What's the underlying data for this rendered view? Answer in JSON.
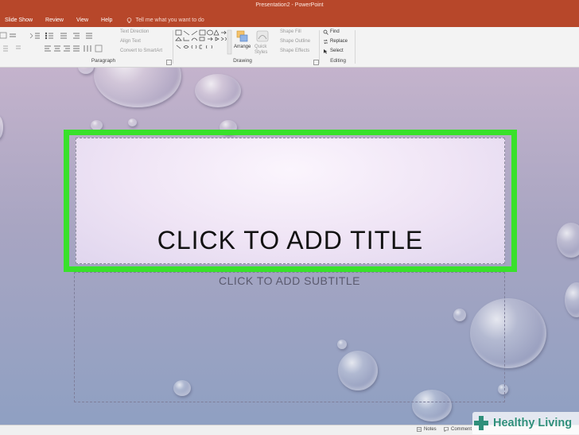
{
  "window": {
    "title": "Presentation2  -  PowerPoint"
  },
  "menu": {
    "tabs": [
      "Slide Show",
      "Review",
      "View",
      "Help"
    ],
    "tell_me_placeholder": "Tell me what you want to do"
  },
  "ribbon": {
    "paragraph": {
      "label": "Paragraph",
      "text_direction": "Text Direction",
      "align_text": "Align Text",
      "convert_smartart": "Convert to SmartArt"
    },
    "drawing": {
      "label": "Drawing",
      "arrange": "Arrange",
      "quick_styles": "Quick Styles",
      "shape_fill": "Shape Fill",
      "shape_outline": "Shape Outline",
      "shape_effects": "Shape Effects"
    },
    "editing": {
      "label": "Editing",
      "find": "Find",
      "replace": "Replace",
      "select": "Select"
    }
  },
  "slide": {
    "title_placeholder": "CLICK TO ADD TITLE",
    "subtitle_placeholder": "CLICK TO ADD SUBTITLE"
  },
  "status": {
    "notes": "Notes",
    "comments": "Comment"
  },
  "watermark": {
    "text": "Healthy Living"
  },
  "colors": {
    "titlebar": "#b7472a",
    "highlight": "#39e12b",
    "ribbon": "#f3f3f3"
  }
}
